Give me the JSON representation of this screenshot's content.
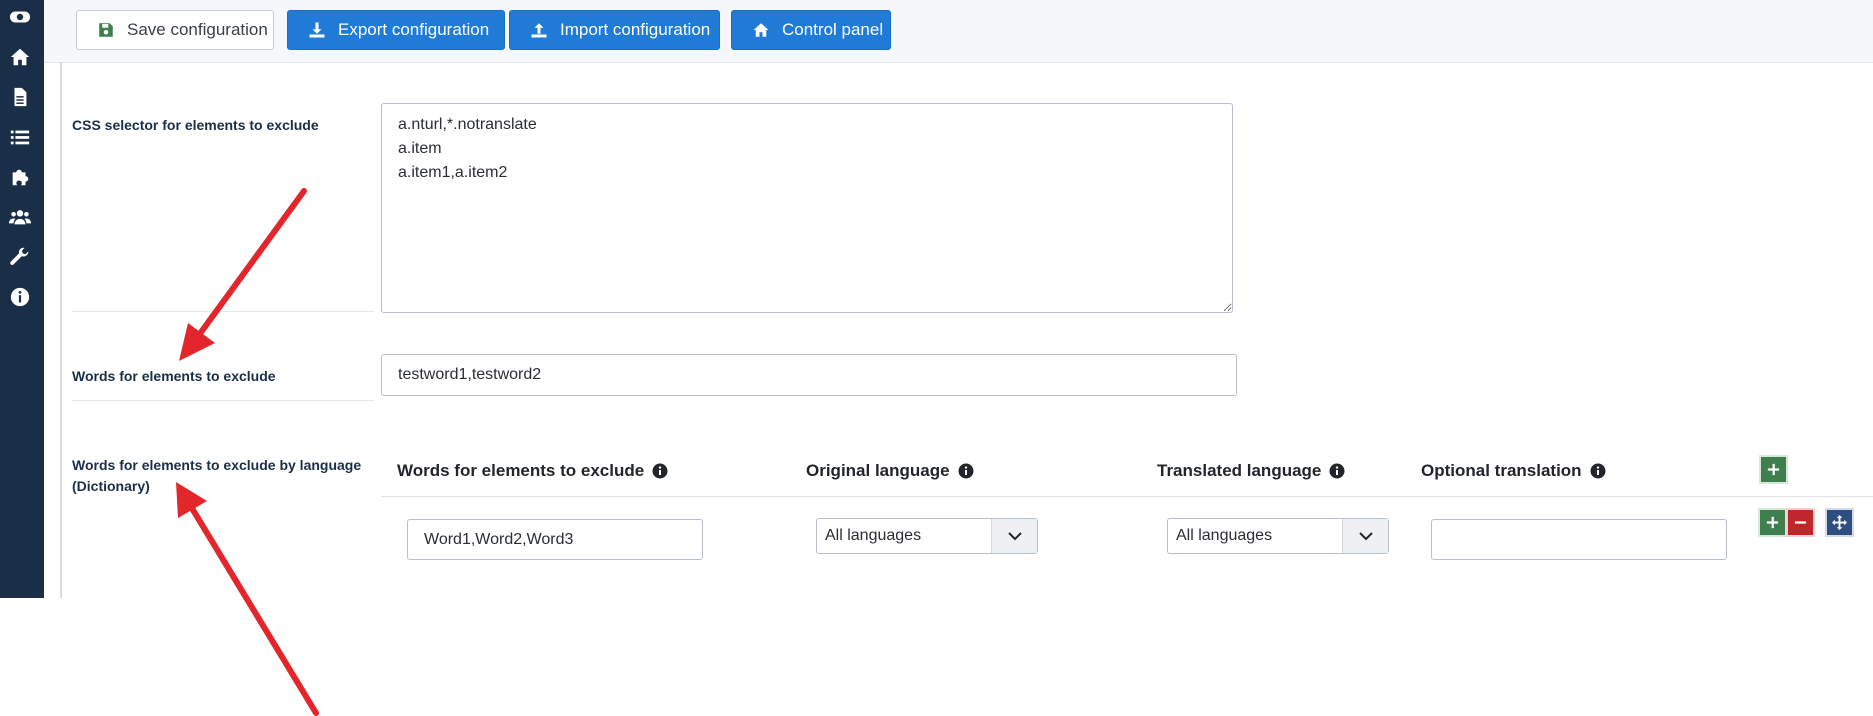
{
  "toolbar": {
    "save_label": "Save configuration",
    "export_label": "Export configuration",
    "import_label": "Import configuration",
    "control_panel_label": "Control panel"
  },
  "sidebar": {
    "items": [
      {
        "icon": "toggle-icon"
      },
      {
        "icon": "home-icon"
      },
      {
        "icon": "file-icon"
      },
      {
        "icon": "list-icon"
      },
      {
        "icon": "puzzle-icon"
      },
      {
        "icon": "users-icon"
      },
      {
        "icon": "wrench-icon"
      },
      {
        "icon": "info-icon"
      }
    ]
  },
  "fields": {
    "css_selector": {
      "label": "CSS selector for elements to exclude",
      "value": "a.nturl,*.notranslate\na.item\na.item1,a.item2"
    },
    "words_exclude": {
      "label": "Words for elements to exclude",
      "value": "testword1,testword2"
    },
    "words_by_language": {
      "label": "Words for elements to exclude by language (Dictionary)"
    }
  },
  "dictionary_table": {
    "headers": {
      "words": "Words for elements to exclude",
      "original_language": "Original language",
      "translated_language": "Translated language",
      "optional_translation": "Optional translation"
    },
    "rows": [
      {
        "words": "Word1,Word2,Word3",
        "original_language": "All languages",
        "translated_language": "All languages",
        "optional_translation": ""
      }
    ]
  },
  "colors": {
    "sidebar": "#1b2e48",
    "primary_button": "#1f7bd6",
    "add_button": "#3f7f4d",
    "remove_button": "#c0272d",
    "move_button": "#2e4d80",
    "annotation_arrow": "#e3262b"
  }
}
